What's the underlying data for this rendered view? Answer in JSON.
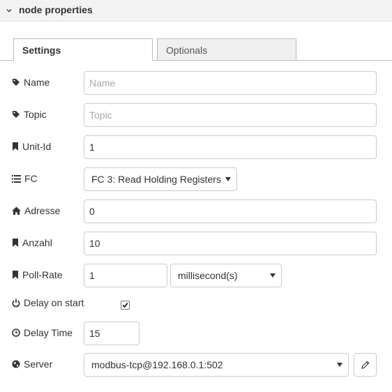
{
  "header": {
    "title": "node properties"
  },
  "tabs": [
    {
      "label": "Settings",
      "active": true
    },
    {
      "label": "Optionals",
      "active": false
    }
  ],
  "fields": {
    "name": {
      "label": "Name",
      "value": "",
      "placeholder": "Name"
    },
    "topic": {
      "label": "Topic",
      "value": "",
      "placeholder": "Topic"
    },
    "unit_id": {
      "label": "Unit-Id",
      "value": "1"
    },
    "fc": {
      "label": "FC",
      "selected": "FC 3: Read Holding Registers"
    },
    "adresse": {
      "label": "Adresse",
      "value": "0"
    },
    "anzahl": {
      "label": "Anzahl",
      "value": "10"
    },
    "poll_rate": {
      "label": "Poll-Rate",
      "value": "1",
      "unit": "millisecond(s)"
    },
    "delay_on_start": {
      "label": "Delay on start",
      "checked": true
    },
    "delay_time": {
      "label": "Delay Time",
      "value": "15"
    },
    "server": {
      "label": "Server",
      "selected": "modbus-tcp@192.168.0.1:502"
    }
  },
  "icons": {
    "chevron": "chevron-down-icon",
    "tag": "tag-icon",
    "bookmark": "bookmark-icon",
    "list": "list-icon",
    "home": "home-icon",
    "power": "power-icon",
    "clock": "clock-icon",
    "globe": "globe-icon",
    "pencil": "pencil-icon"
  }
}
